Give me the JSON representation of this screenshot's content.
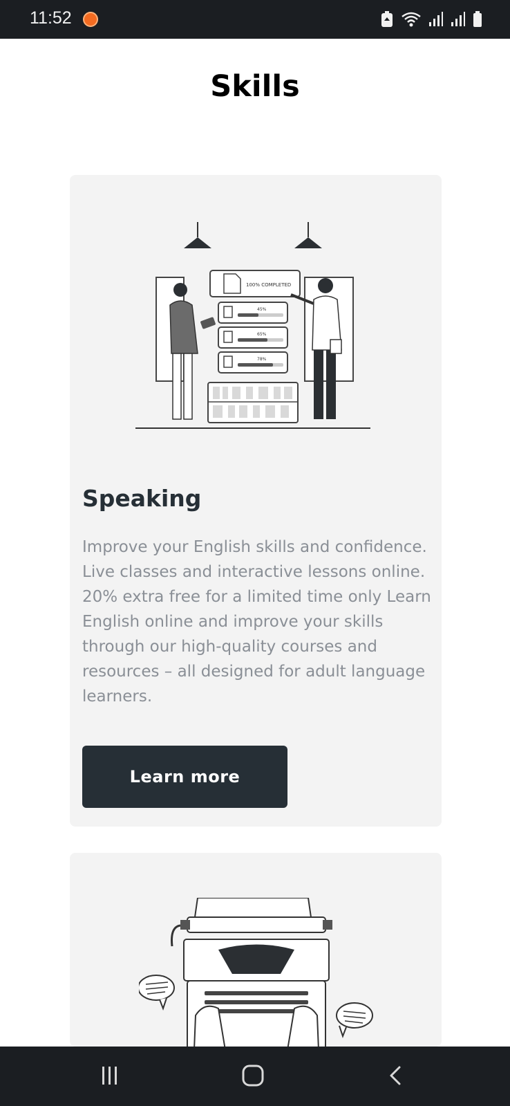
{
  "status_bar": {
    "time": "11:52",
    "icons": [
      "app-notification-icon",
      "recycle-icon",
      "wifi-icon",
      "signal-icon",
      "signal-icon",
      "battery-icon"
    ]
  },
  "page": {
    "title": "Skills"
  },
  "cards": [
    {
      "illustration": "people-with-progress-charts-illustration",
      "heading": "Speaking",
      "body": "Improve your English skills and confidence. Live classes and interactive lessons online. 20% extra free for a limited time only Learn English online and improve your skills through our high-quality courses and resources – all designed for adult language learners.",
      "button_label": "Learn more",
      "illustration_labels": {
        "banner": "100% COMPLETED",
        "bar1": "45%",
        "bar2": "65%",
        "bar3": "78%"
      }
    },
    {
      "illustration": "typewriter-illustration"
    }
  ],
  "nav_bar": {
    "buttons": [
      "recent-apps-icon",
      "home-icon",
      "back-icon"
    ]
  },
  "colors": {
    "status_bar": "#1b1e22",
    "card_bg": "#f3f3f3",
    "button_bg": "#262f36",
    "body_text": "#8a8f96",
    "heading": "#262f36"
  }
}
